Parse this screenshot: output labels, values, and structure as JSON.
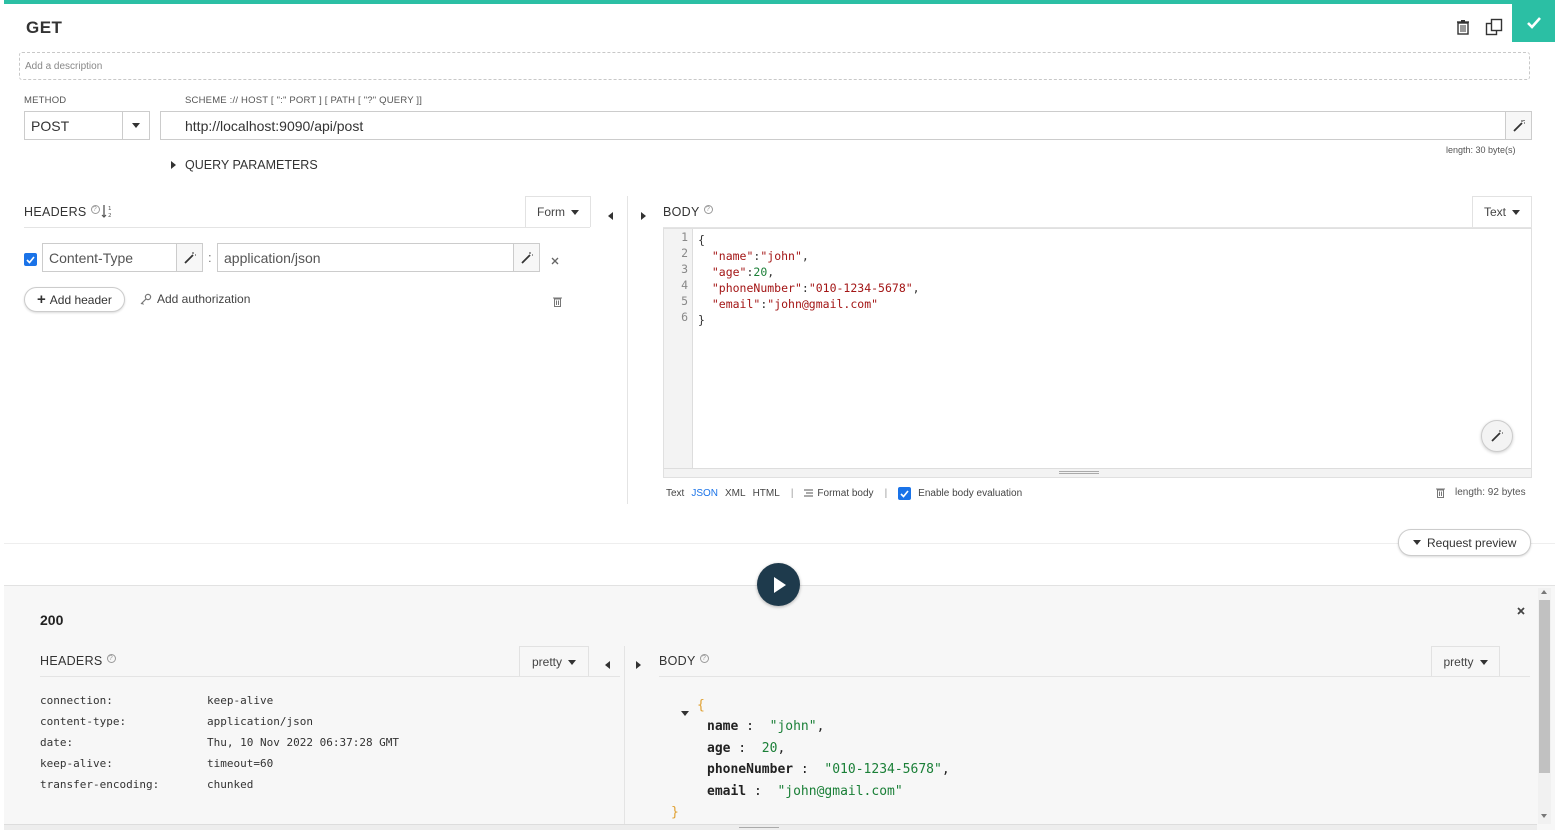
{
  "request": {
    "title": "GET",
    "description_placeholder": "Add a description",
    "method_label": "METHOD",
    "method_value": "POST",
    "url_label": "SCHEME :// HOST [ \":\" PORT ] [ PATH [ \"?\" QUERY ]]",
    "url_value": "http://localhost:9090/api/post",
    "url_length": "length: 30 byte(s)",
    "query_parameters": "QUERY PARAMETERS"
  },
  "headers": {
    "title": "HEADERS",
    "mode": "Form",
    "rows": [
      {
        "name": "Content-Type",
        "separator": ":",
        "value": "application/json",
        "checked": true
      }
    ],
    "add_header": "Add header",
    "add_authorization": "Add authorization"
  },
  "body": {
    "title": "BODY",
    "mode": "Text",
    "line_numbers": [
      "1",
      "2",
      "3",
      "4",
      "5",
      "6"
    ],
    "lines": [
      {
        "p1": "{",
        "key": "",
        "sep": "",
        "val": "",
        "end": ""
      },
      {
        "p1": "  ",
        "key": "\"name\"",
        "sep": ":",
        "val": "\"john\"",
        "end": ","
      },
      {
        "p1": "  ",
        "key": "\"age\"",
        "sep": ":",
        "val": "20",
        "end": ","
      },
      {
        "p1": "  ",
        "key": "\"phoneNumber\"",
        "sep": ":",
        "val": "\"010-1234-5678\"",
        "end": ","
      },
      {
        "p1": "  ",
        "key": "\"email\"",
        "sep": ":",
        "val": "\"john@gmail.com\"",
        "end": ""
      },
      {
        "p1": "}",
        "key": "",
        "sep": "",
        "val": "",
        "end": ""
      }
    ],
    "footer": {
      "text": "Text",
      "json": "JSON",
      "xml": "XML",
      "html": "HTML",
      "divider": "|",
      "format_body": "Format body",
      "enable_eval": "Enable body evaluation",
      "length": "length: 92 bytes"
    }
  },
  "request_preview": "Request preview",
  "response": {
    "status": "200",
    "headers_title": "HEADERS",
    "headers_mode": "pretty",
    "headers": [
      {
        "k": "connection:",
        "v": "keep-alive"
      },
      {
        "k": "content-type:",
        "v": "application/json"
      },
      {
        "k": "date:",
        "v": "Thu, 10 Nov 2022 06:37:28 GMT"
      },
      {
        "k": "keep-alive:",
        "v": "timeout=60"
      },
      {
        "k": "transfer-encoding:",
        "v": "chunked"
      }
    ],
    "body_title": "BODY",
    "body_mode": "pretty",
    "json": {
      "open": "{",
      "close": "}",
      "fields": [
        {
          "key": "name",
          "colon": " :  ",
          "val": "\"john\"",
          "end": ","
        },
        {
          "key": "age",
          "colon": " :  ",
          "val": "20",
          "end": ","
        },
        {
          "key": "phoneNumber",
          "colon": " :  ",
          "val": "\"010-1234-5678\"",
          "end": ","
        },
        {
          "key": "email",
          "colon": " :  ",
          "val": "\"john@gmail.com\"",
          "end": ""
        }
      ]
    }
  },
  "colors": {
    "accent": "#2bbfa4",
    "checkbox": "#1a73e8",
    "play_button": "#1e3a4c",
    "string_red": "#a31515",
    "number_green": "#1a7f37"
  }
}
